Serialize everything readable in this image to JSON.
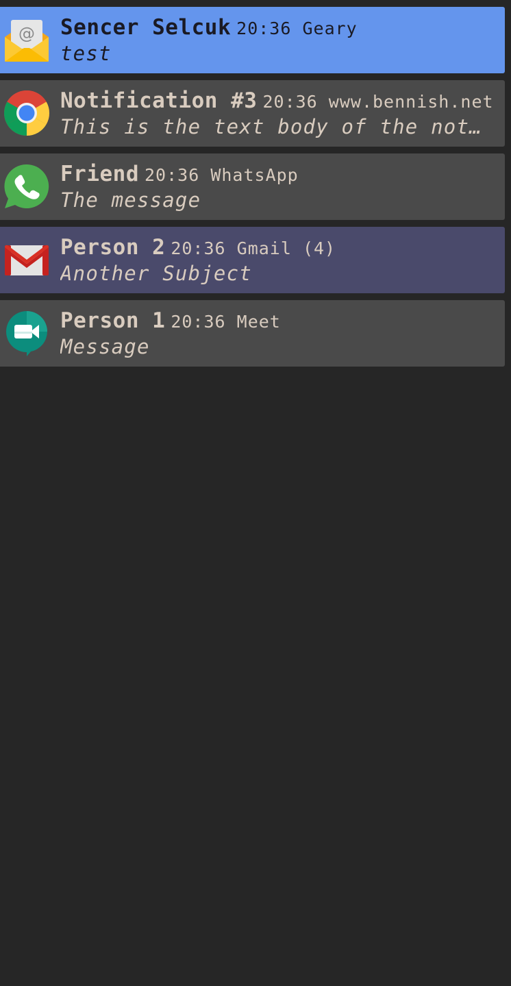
{
  "notifications": [
    {
      "summary": "Sencer Selcuk",
      "time": "20:36",
      "app": "Geary",
      "body": "test",
      "icon": "geary-mail-icon",
      "background": "#6495ed"
    },
    {
      "summary": "Notification #3",
      "time": "20:36",
      "app": "www.bennish.net",
      "body": "This is the text body of the not…",
      "icon": "chrome-icon",
      "background": "#4a4a4a"
    },
    {
      "summary": "Friend",
      "time": "20:36",
      "app": "WhatsApp",
      "body": "The message",
      "icon": "whatsapp-icon",
      "background": "#4a4a4a"
    },
    {
      "summary": "Person 2",
      "time": "20:36",
      "app": "Gmail (4)",
      "body": "Another Subject",
      "icon": "gmail-icon",
      "background": "#4a4a6b"
    },
    {
      "summary": "Person 1",
      "time": "20:36",
      "app": "Meet",
      "body": "Message",
      "icon": "google-meet-icon",
      "background": "#4a4a4a"
    }
  ]
}
